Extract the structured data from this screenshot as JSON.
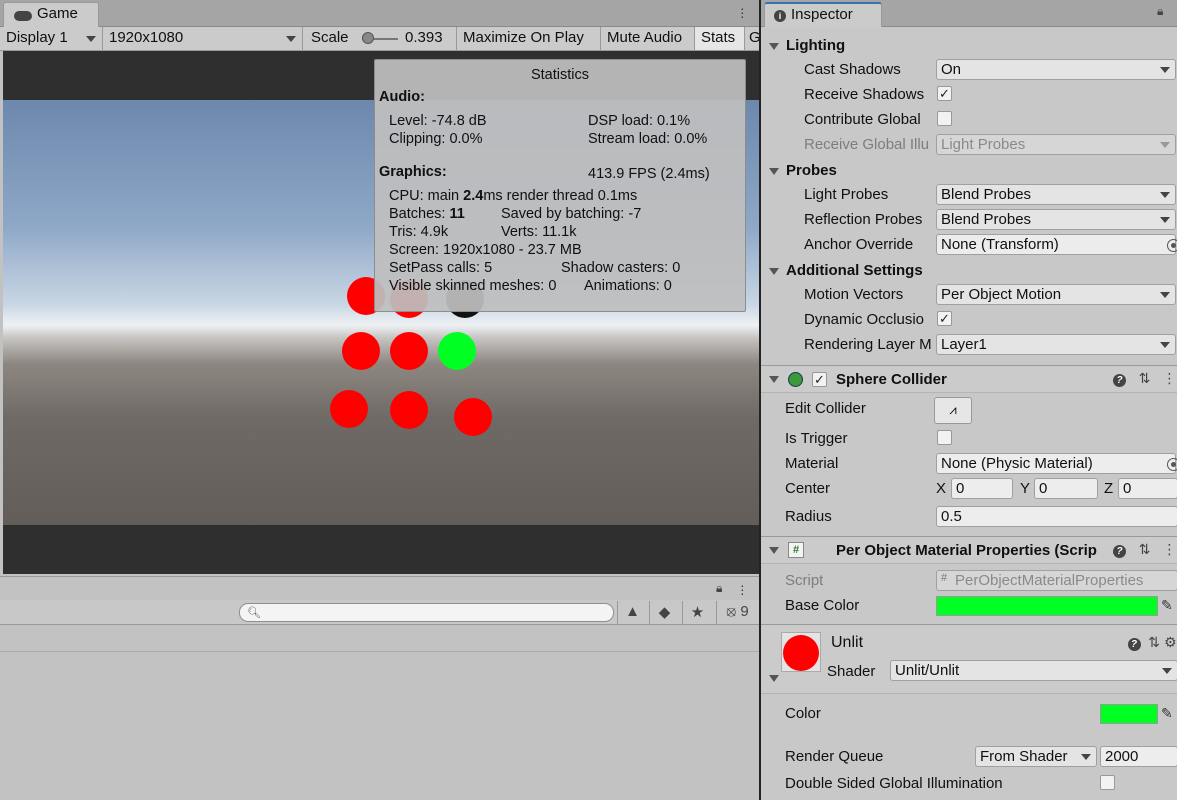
{
  "game": {
    "tab_label": "Game",
    "display_label": "Display 1",
    "resolution_label": "1920x1080",
    "scale_label": "Scale",
    "scale_value": "0.393",
    "maximize_label": "Maximize On Play",
    "mute_label": "Mute Audio",
    "stats_label": "Stats",
    "gizmos_label": "G"
  },
  "statistics": {
    "title": "Statistics",
    "audio_header": "Audio:",
    "level": "Level: -74.8 dB",
    "dsp_load": "DSP load: 0.1%",
    "clipping": "Clipping: 0.0%",
    "stream_load": "Stream load: 0.0%",
    "graphics_header": "Graphics:",
    "fps": "413.9 FPS (2.4ms)",
    "cpu_prefix": "CPU: main ",
    "cpu_main": "2.4",
    "cpu_suffix": "ms  render thread 0.1ms",
    "batches_prefix": "Batches: ",
    "batches_value": "11",
    "saved_by_batching": "Saved by batching: -7",
    "tris": "Tris: 4.9k",
    "verts": "Verts: 11.1k",
    "screen": "Screen: 1920x1080 - 23.7 MB",
    "setpass": "SetPass calls: 5",
    "shadow_casters": "Shadow casters: 0",
    "skinned_meshes": "Visible skinned meshes: 0",
    "animations": "Animations: 0"
  },
  "hierarchy": {
    "search_placeholder": "",
    "hidden_count": "9"
  },
  "inspector": {
    "tab_label": "Inspector",
    "lighting": {
      "header": "Lighting",
      "cast_shadows_label": "Cast Shadows",
      "cast_shadows_value": "On",
      "receive_shadows_label": "Receive Shadows",
      "receive_shadows_checked": true,
      "contribute_gi_label": "Contribute Global",
      "contribute_gi_checked": false,
      "receive_gi_label": "Receive Global Illu",
      "receive_gi_value": "Light Probes"
    },
    "probes": {
      "header": "Probes",
      "light_probes_label": "Light Probes",
      "light_probes_value": "Blend Probes",
      "reflection_probes_label": "Reflection Probes",
      "reflection_probes_value": "Blend Probes",
      "anchor_override_label": "Anchor Override",
      "anchor_override_value": "None (Transform)"
    },
    "additional": {
      "header": "Additional Settings",
      "motion_vectors_label": "Motion Vectors",
      "motion_vectors_value": "Per Object Motion",
      "dynamic_occlusion_label": "Dynamic Occlusio",
      "dynamic_occlusion_checked": true,
      "rendering_layer_label": "Rendering Layer M",
      "rendering_layer_value": "Layer1"
    },
    "sphere_collider": {
      "title": "Sphere Collider",
      "enabled": true,
      "edit_collider_label": "Edit Collider",
      "is_trigger_label": "Is Trigger",
      "is_trigger_checked": false,
      "material_label": "Material",
      "material_value": "None (Physic Material)",
      "center_label": "Center",
      "center_x_label": "X",
      "center_x": "0",
      "center_y_label": "Y",
      "center_y": "0",
      "center_z_label": "Z",
      "center_z": "0",
      "radius_label": "Radius",
      "radius_value": "0.5"
    },
    "per_object": {
      "title": "Per Object Material Properties (Scrip",
      "script_label": "Script",
      "script_value": "PerObjectMaterialProperties",
      "base_color_label": "Base Color",
      "base_color": "#00ff22"
    },
    "material": {
      "name": "Unlit",
      "shader_label": "Shader",
      "shader_value": "Unlit/Unlit",
      "color_label": "Color",
      "color": "#00ff22",
      "render_queue_label": "Render Queue",
      "render_queue_mode": "From Shader",
      "render_queue_value": "2000",
      "double_sided_gi_label": "Double Sided Global Illumination",
      "double_sided_gi_checked": false
    }
  },
  "colors": {
    "ball_red": "#ff0000",
    "ball_green": "#00ff22",
    "ball_black": "#111111",
    "accent_tab": "#3a72b0"
  }
}
